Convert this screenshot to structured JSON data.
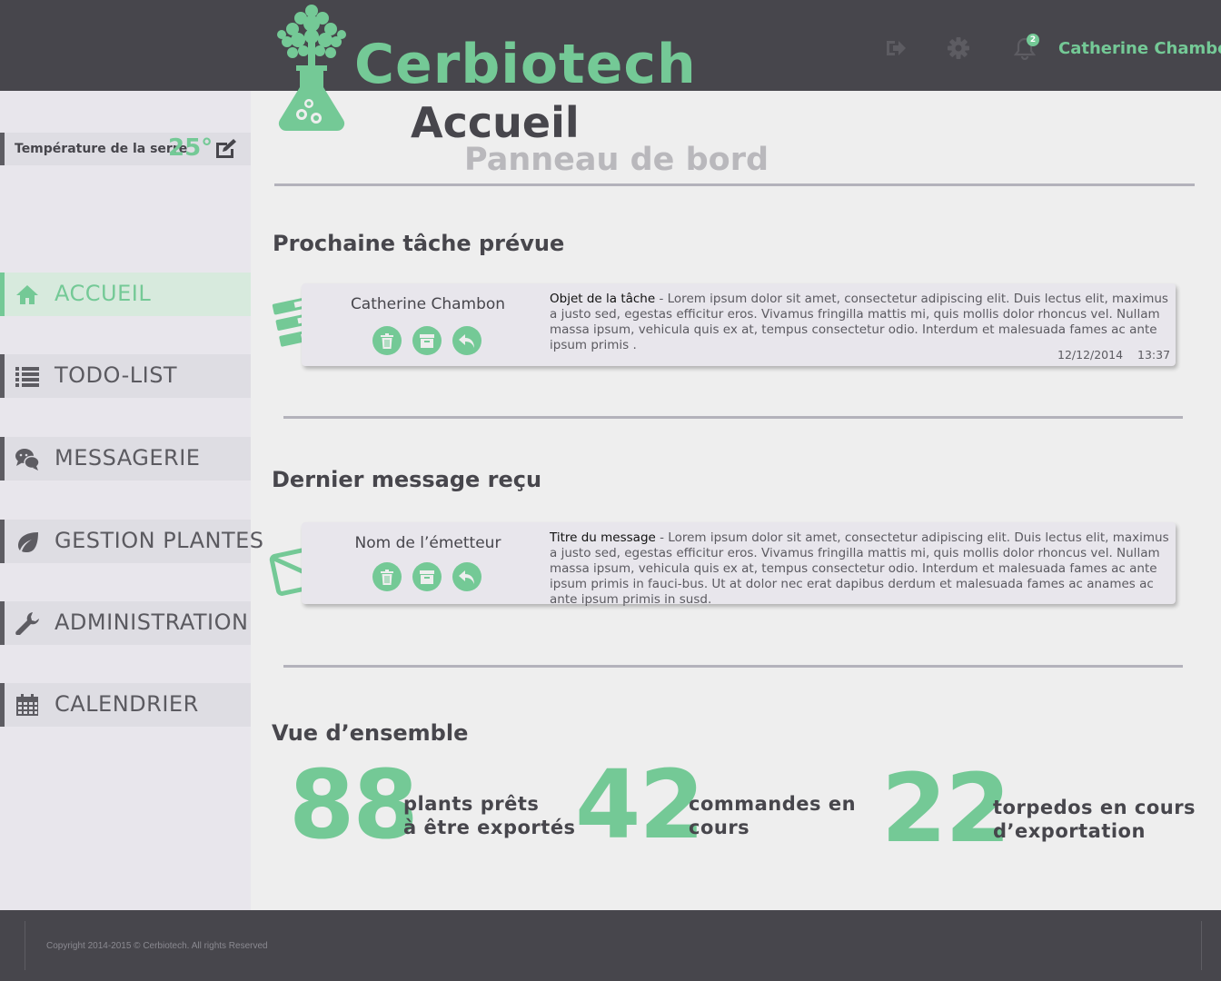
{
  "app": {
    "brand": "Cerbiotech",
    "user_name": "Catherine Chambon",
    "notification_count": "2"
  },
  "colors": {
    "accent": "#74c996",
    "dark": "#47464c",
    "sidebar": "#e8e6ec"
  },
  "header": {
    "icons": [
      "logout-icon",
      "gear-icon",
      "bell-icon"
    ]
  },
  "sidebar": {
    "temperature_label": "Température de la serre",
    "temperature_value": "25°",
    "items": [
      {
        "label": "ACCUEIL",
        "icon": "home-icon",
        "active": true
      },
      {
        "label": "TODO-LIST",
        "icon": "list-icon",
        "active": false
      },
      {
        "label": "MESSAGERIE",
        "icon": "chat-icon",
        "active": false
      },
      {
        "label": "GESTION PLANTES",
        "icon": "leaf-icon",
        "active": false
      },
      {
        "label": "ADMINISTRATION",
        "icon": "wrench-icon",
        "active": false
      },
      {
        "label": "CALENDRIER",
        "icon": "calendar-icon",
        "active": false
      }
    ]
  },
  "page": {
    "title": "Accueil",
    "subtitle": "Panneau de bord"
  },
  "next_task": {
    "section_title": "Prochaine tâche prévue",
    "author": "Catherine Chambon",
    "subject": "Objet de la tâche",
    "separator": " - ",
    "body": "Lorem ipsum dolor sit amet, consectetur adipiscing elit. Duis lectus elit, maximus a justo sed, egestas efficitur eros. Vivamus fringilla mattis mi, quis mollis dolor rhoncus vel. Nullam massa ipsum, vehicula quis ex at, tempus consectetur odio. Interdum et malesuada fames ac ante ipsum primis .",
    "date": "12/12/2014",
    "time": "13:37"
  },
  "last_message": {
    "section_title": "Dernier message reçu",
    "sender": "Nom de l’émetteur",
    "subject": "Titre du message",
    "separator": " - ",
    "body": "Lorem ipsum dolor sit amet, consectetur adipiscing elit. Duis lectus elit, maximus a justo sed, egestas efficitur eros. Vivamus fringilla mattis mi, quis mollis dolor rhoncus vel. Nullam massa ipsum, vehicula quis ex at, tempus consectetur odio. Interdum et malesuada fames ac ante ipsum primis in fauci-bus. Ut at dolor nec erat dapibus derdum et malesuada fames ac anames ac ante ipsum primis in susd."
  },
  "overview": {
    "section_title": "Vue d’ensemble",
    "stats": [
      {
        "value": "88",
        "label_line1": "plants prêts",
        "label_line2": "à être exportés"
      },
      {
        "value": "42",
        "label_line1": "commandes en",
        "label_line2": "cours"
      },
      {
        "value": "22",
        "label_line1": "torpedos en cours",
        "label_line2": "d’exportation"
      }
    ]
  },
  "footer": {
    "copyright": "Copyright 2014-2015 © Cerbiotech. All rights Reserved"
  }
}
